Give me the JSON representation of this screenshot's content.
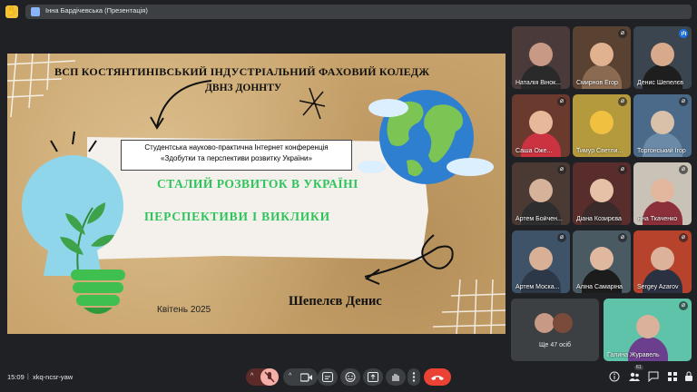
{
  "header": {
    "presenter_label": "Інна Бардічевська (Презентація)",
    "hand_badge": "✋"
  },
  "slide": {
    "title_line1": "ВСП КОСТЯНТИНІВСЬКИЙ ІНДУСТРІАЛЬНИЙ ФАХОВИЙ КОЛЕДЖ",
    "title_line2": "ДВНЗ ДОННТУ",
    "conference_line1": "Студентська науково-практична Інтернет конференція",
    "conference_line2": "«Здобутки та перспективи розвитку України»",
    "topic_line1": "СТАЛИЙ РОЗВИТОК В УКРАЇНІ",
    "topic_line2": "ПЕРСПЕКТИВИ   І ВИКЛИКИ",
    "date": "Квітень 2025",
    "author": "Шепелєв  Денис"
  },
  "participants": [
    {
      "name": "Наталія Вінок...",
      "state": "none",
      "bg": "#4a3b3a",
      "skin": "#c89a86",
      "cloth": "#2a2a2a"
    },
    {
      "name": "Смирнов Егор",
      "state": "muted",
      "bg": "#5a4232",
      "skin": "#e0b28f",
      "cloth": "#8a6a50"
    },
    {
      "name": "Денис Шепелєв",
      "state": "speaking",
      "bg": "#3b4550",
      "skin": "#d9a98c",
      "cloth": "#1e1e1e"
    },
    {
      "name": "Саша Оже...",
      "state": "muted",
      "bg": "#6b3a2e",
      "skin": "#e7b89a",
      "cloth": "#cc3340"
    },
    {
      "name": "Тимур Светли...",
      "state": "muted",
      "bg": "#b49a3c",
      "skin": "#f0c040",
      "cloth": "#b49a3c"
    },
    {
      "name": "Торгонський Ігор",
      "state": "muted",
      "bg": "#4b6a8a",
      "skin": "#d9c0a8",
      "cloth": "#6a8aa8"
    },
    {
      "name": "Артем Бойчен...",
      "state": "muted",
      "bg": "#4a3a33",
      "skin": "#d7b29a",
      "cloth": "#2e2e2e"
    },
    {
      "name": "Діана Козирєва",
      "state": "muted",
      "bg": "#5a2d2d",
      "skin": "#e6c1a8",
      "cloth": "#3a2a2a"
    },
    {
      "name": "Яна Ткаченко",
      "state": "muted",
      "bg": "#c9c2b6",
      "skin": "#e2b79d",
      "cloth": "#8b2f3a"
    },
    {
      "name": "Артем Моска...",
      "state": "muted",
      "bg": "#3e5268",
      "skin": "#d8b096",
      "cloth": "#2c3848"
    },
    {
      "name": "Аліна Самаріна",
      "state": "muted",
      "bg": "#4a5a63",
      "skin": "#e0b8a0",
      "cloth": "#1c1c1c"
    },
    {
      "name": "Sergey Azarov",
      "state": "muted",
      "bg": "#b8432c",
      "skin": "#dcb29a",
      "cloth": "#2a3140"
    },
    {
      "name": "Галина Журавель",
      "state": "muted",
      "bg": "#5ec3a8",
      "skin": "#dab19a",
      "cloth": "#6c3e8e"
    }
  ],
  "more_tile": {
    "label": "Ще 47 осіб"
  },
  "bottom": {
    "time": "15:09",
    "meeting_code": "xkq-ncsr-yaw",
    "participants_badge": "61"
  },
  "colors": {
    "end_call": "#ea4335",
    "mic_off": "#f6aea9",
    "speaking": "#1a73e8",
    "topic_green": "#2ec45b"
  }
}
